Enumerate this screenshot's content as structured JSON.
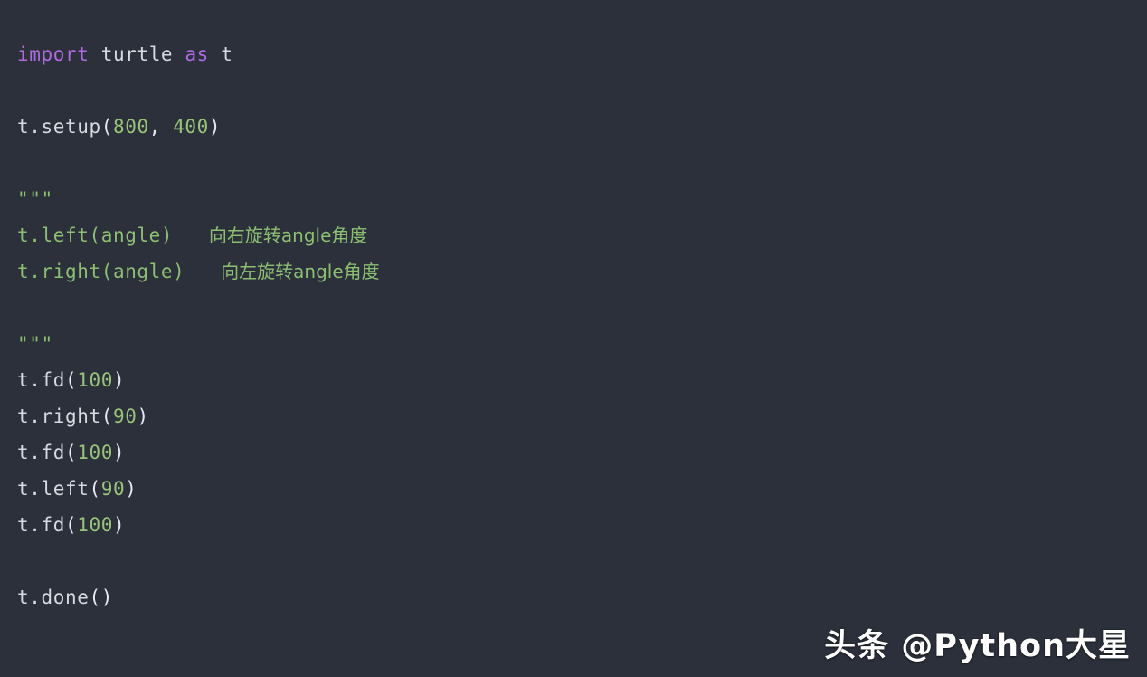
{
  "editor": {
    "background_color": "#2b303b",
    "default_text_color": "#d7dae0",
    "language": "python",
    "colors": {
      "keyword": "#b06be3",
      "number": "#98c379",
      "string": "#8cbf72",
      "comment": "#8cbf72",
      "punctuation": "#e6e9ef"
    }
  },
  "code": {
    "lines": [
      {
        "index": 1,
        "text": "import turtle as t",
        "tokens": [
          {
            "text": "import",
            "type": "keyword"
          },
          {
            "text": " ",
            "type": "plain"
          },
          {
            "text": "turtle",
            "type": "plain"
          },
          {
            "text": " ",
            "type": "plain"
          },
          {
            "text": "as",
            "type": "keyword"
          },
          {
            "text": " ",
            "type": "plain"
          },
          {
            "text": "t",
            "type": "plain"
          }
        ]
      },
      {
        "index": 2,
        "text": "",
        "tokens": []
      },
      {
        "index": 3,
        "text": "t.setup(800, 400)",
        "tokens": [
          {
            "text": "t.setup",
            "type": "plain"
          },
          {
            "text": "(",
            "type": "punct"
          },
          {
            "text": "800",
            "type": "number"
          },
          {
            "text": ", ",
            "type": "punct"
          },
          {
            "text": "400",
            "type": "number"
          },
          {
            "text": ")",
            "type": "punct"
          }
        ]
      },
      {
        "index": 4,
        "text": "",
        "tokens": []
      },
      {
        "index": 5,
        "text": "\"\"\"",
        "tokens": [
          {
            "text": "\"\"\"",
            "type": "string"
          }
        ]
      },
      {
        "index": 6,
        "text": "t.left(angle)   向右旋转angle角度",
        "tokens": [
          {
            "text": "t.left(angle)",
            "type": "string"
          },
          {
            "text": "   ",
            "type": "string"
          },
          {
            "text": "向右旋转angle角度",
            "type": "string-cjk"
          }
        ]
      },
      {
        "index": 7,
        "text": "t.right(angle)   向左旋转angle角度",
        "tokens": [
          {
            "text": "t.right(angle)",
            "type": "string"
          },
          {
            "text": "   ",
            "type": "string"
          },
          {
            "text": "向左旋转angle角度",
            "type": "string-cjk"
          }
        ]
      },
      {
        "index": 8,
        "text": "",
        "tokens": []
      },
      {
        "index": 9,
        "text": "\"\"\"",
        "tokens": [
          {
            "text": "\"\"\"",
            "type": "string"
          }
        ]
      },
      {
        "index": 10,
        "text": "t.fd(100)",
        "tokens": [
          {
            "text": "t.fd",
            "type": "plain"
          },
          {
            "text": "(",
            "type": "punct"
          },
          {
            "text": "100",
            "type": "number"
          },
          {
            "text": ")",
            "type": "punct"
          }
        ]
      },
      {
        "index": 11,
        "text": "t.right(90)",
        "tokens": [
          {
            "text": "t.right",
            "type": "plain"
          },
          {
            "text": "(",
            "type": "punct"
          },
          {
            "text": "90",
            "type": "number"
          },
          {
            "text": ")",
            "type": "punct"
          }
        ]
      },
      {
        "index": 12,
        "text": "t.fd(100)",
        "tokens": [
          {
            "text": "t.fd",
            "type": "plain"
          },
          {
            "text": "(",
            "type": "punct"
          },
          {
            "text": "100",
            "type": "number"
          },
          {
            "text": ")",
            "type": "punct"
          }
        ]
      },
      {
        "index": 13,
        "text": "t.left(90)",
        "tokens": [
          {
            "text": "t.left",
            "type": "plain"
          },
          {
            "text": "(",
            "type": "punct"
          },
          {
            "text": "90",
            "type": "number"
          },
          {
            "text": ")",
            "type": "punct"
          }
        ]
      },
      {
        "index": 14,
        "text": "t.fd(100)",
        "tokens": [
          {
            "text": "t.fd",
            "type": "plain"
          },
          {
            "text": "(",
            "type": "punct"
          },
          {
            "text": "100",
            "type": "number"
          },
          {
            "text": ")",
            "type": "punct"
          }
        ]
      },
      {
        "index": 15,
        "text": "",
        "tokens": []
      },
      {
        "index": 16,
        "text": "t.done()",
        "tokens": [
          {
            "text": "t.done",
            "type": "plain"
          },
          {
            "text": "()",
            "type": "punct"
          }
        ]
      }
    ]
  },
  "watermark": {
    "text": "头条 @Python大星",
    "color": "#ffffff"
  }
}
